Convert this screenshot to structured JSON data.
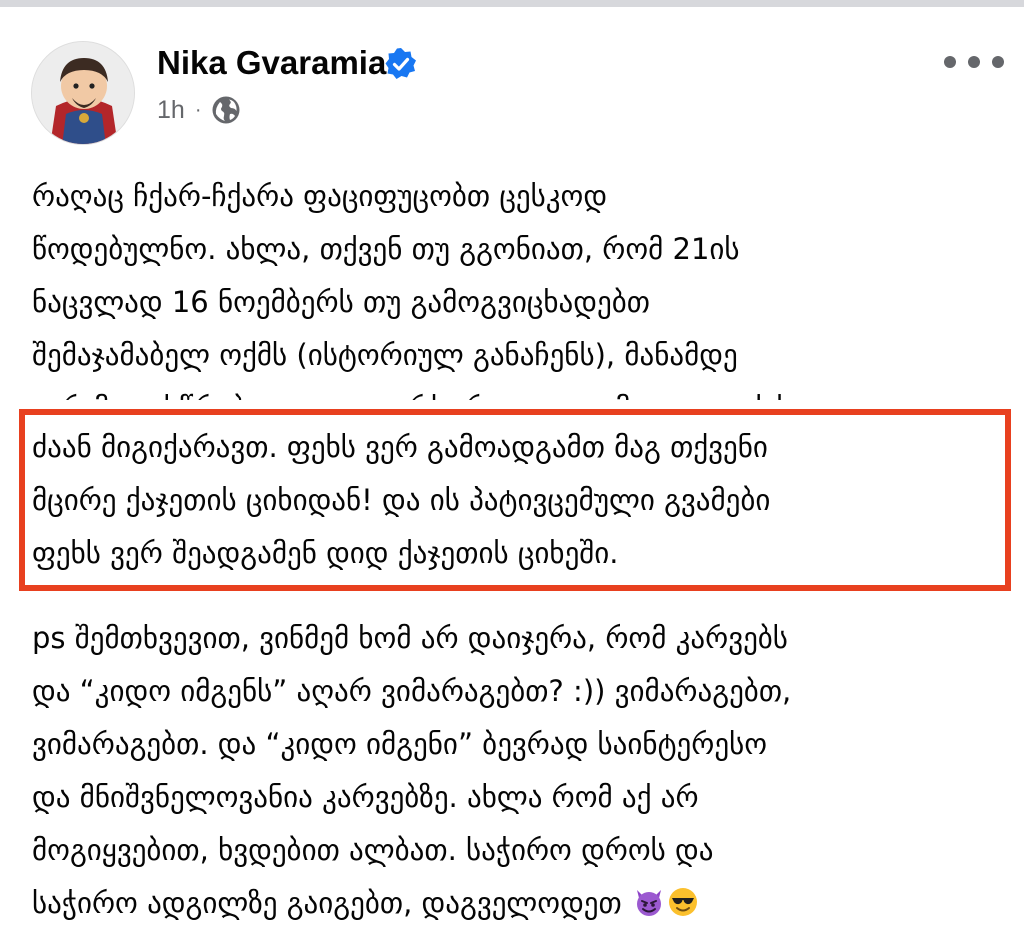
{
  "post": {
    "author": "Nika Gvaramia",
    "time": "1h",
    "separator": "·",
    "privacy_icon": "globe-icon",
    "verified_icon": "verified-badge-icon",
    "more_icon": "more-options-icon",
    "paragraph_1": [
      "რაღაც ჩქარ-ჩქარა ფაციფუცობთ ცესკოდ",
      "წოდებულნო. ახლა, თქვენ თუ გგონიათ, რომ 21ის",
      "ნაცვლად 16 ნოემბერს თუ გამოგვიცხადებთ",
      "შემაჯამაბელ ოქმს (ისტორიულ განაჩენს), მანამდე",
      "ვერ მოგისწრებთ ყველაფერს, რაც დაგეგმილი გვაქვს,"
    ],
    "paragraph_highlighted": [
      "ძაან მიგიქარავთ. ფეხს ვერ გამოადგამთ მაგ თქვენი",
      "მცირე ქაჯეთის ციხიდან! და ის პატივცემული გვამები",
      "ფეხს ვერ შეადგამენ დიდ ქაჯეთის ციხეში."
    ],
    "paragraph_ps": [
      "ps შემთხვევით, ვინმემ ხომ არ დაიჯერა, რომ კარვებს",
      "და “კიდო იმგენს” აღარ ვიმარაგებთ? :)) ვიმარაგებთ,",
      "ვიმარაგებთ. და “კიდო იმგენი” ბევრად საინტერესო",
      "და მნიშვნელოვანია კარვებზე. ახლა რომ აქ არ",
      "მოგიყვებით, ხვდებით ალბათ. საჭირო დროს და",
      "საჭირო ადგილზე გაიგებთ, დაგველოდეთ"
    ],
    "emojis": [
      "smiling-devil-emoji",
      "sunglasses-emoji"
    ]
  },
  "colors": {
    "highlight_border": "#e8401f",
    "verified": "#1877f2",
    "meta_text": "#65676b"
  }
}
